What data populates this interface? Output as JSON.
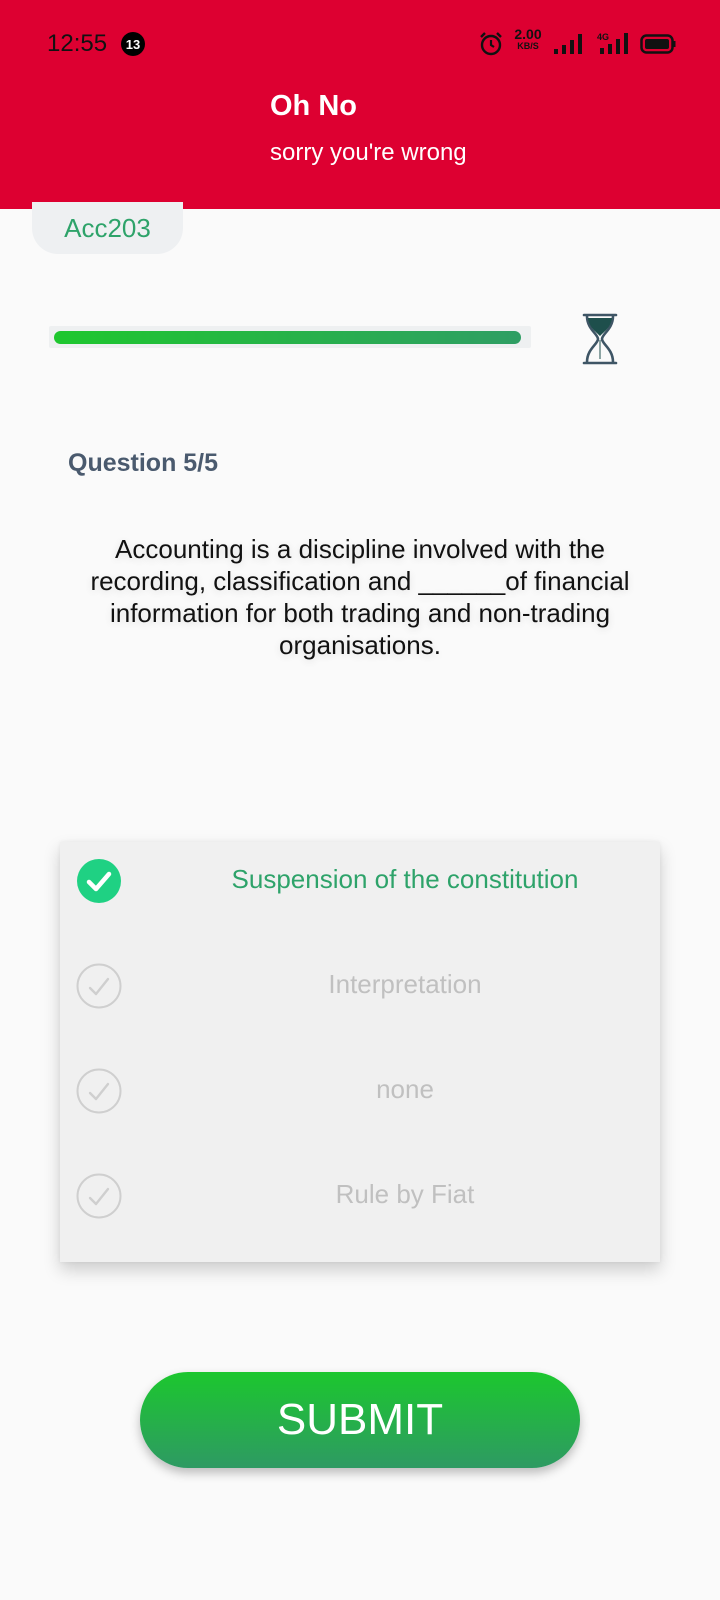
{
  "status_bar": {
    "time": "12:55",
    "notification_count": "13",
    "net_speed_value": "2.00",
    "net_speed_unit": "KB/S",
    "network_label": "4G"
  },
  "header": {
    "title": "Oh No",
    "subtitle": "sorry you're wrong",
    "background_color": "#dd0031"
  },
  "course_chip": "Acc203",
  "timer": {
    "remaining_fraction": 0.99,
    "icon": "hourglass-icon"
  },
  "question": {
    "counter": "Question 5/5",
    "text": "Accounting is a discipline involved with the recording, classification and ______of financial information for both trading and non-trading organisations."
  },
  "options": [
    {
      "label": "Suspension of the constitution",
      "selected": true
    },
    {
      "label": "Interpretation",
      "selected": false
    },
    {
      "label": "none",
      "selected": false
    },
    {
      "label": "Rule by Fiat",
      "selected": false
    }
  ],
  "submit_label": "SUBMIT",
  "colors": {
    "accent_green": "#2ea36a",
    "selected_check": "#1fd183",
    "unselected_text": "#c0c0c0"
  }
}
